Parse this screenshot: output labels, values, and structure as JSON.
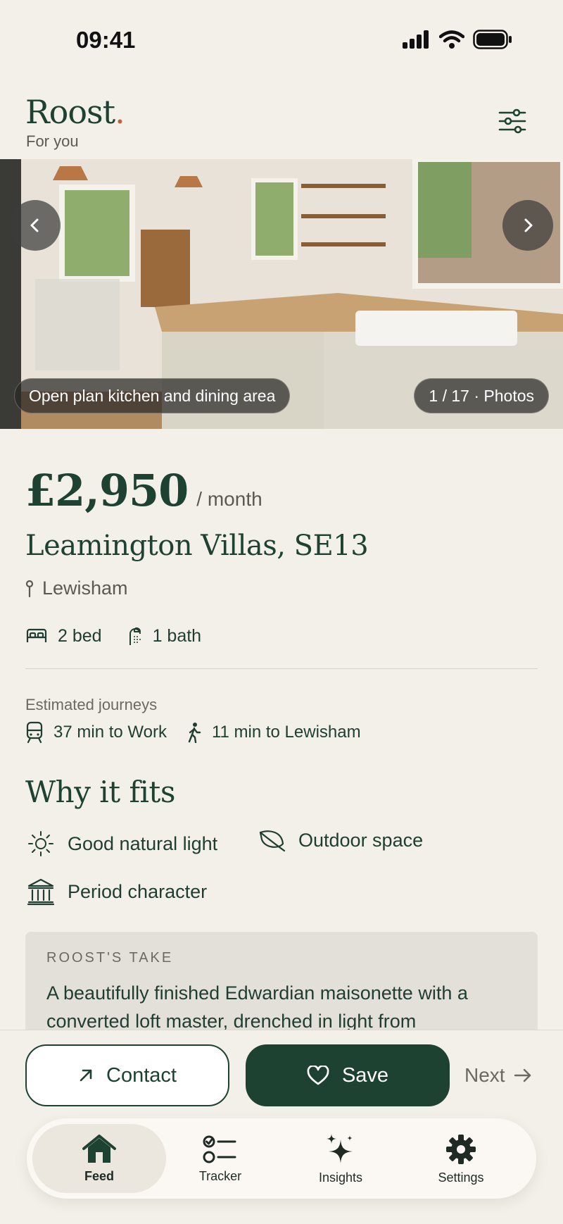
{
  "status": {
    "time": "09:41"
  },
  "header": {
    "brand": "Roost",
    "brand_dot": ".",
    "subtitle": "For you"
  },
  "gallery": {
    "caption": "Open plan kitchen and dining area",
    "counter": "1 / 17 · Photos"
  },
  "listing": {
    "price": "£2,950",
    "per": "/ month",
    "address": "Leamington Villas, SE13",
    "area": "Lewisham",
    "beds": "2 bed",
    "baths": "1 bath"
  },
  "journeys": {
    "heading": "Estimated journeys",
    "work": "37 min to Work",
    "walk": "11 min to Lewisham"
  },
  "why": {
    "heading": "Why it fits",
    "features": [
      "Good natural light",
      "Outdoor space",
      "Period character"
    ]
  },
  "take": {
    "label": "ROOST'S TAKE",
    "text": "A beautifully finished Edwardian maisonette with a converted loft master, drenched in light from"
  },
  "actions": {
    "contact": "Contact",
    "save": "Save",
    "next": "Next"
  },
  "tabs": [
    {
      "label": "Feed",
      "icon": "home-icon"
    },
    {
      "label": "Tracker",
      "icon": "checklist-icon"
    },
    {
      "label": "Insights",
      "icon": "sparkle-icon"
    },
    {
      "label": "Settings",
      "icon": "gear-icon"
    }
  ],
  "colors": {
    "primary": "#1d4232",
    "accent": "#c0623b",
    "background": "#f3efe9"
  }
}
